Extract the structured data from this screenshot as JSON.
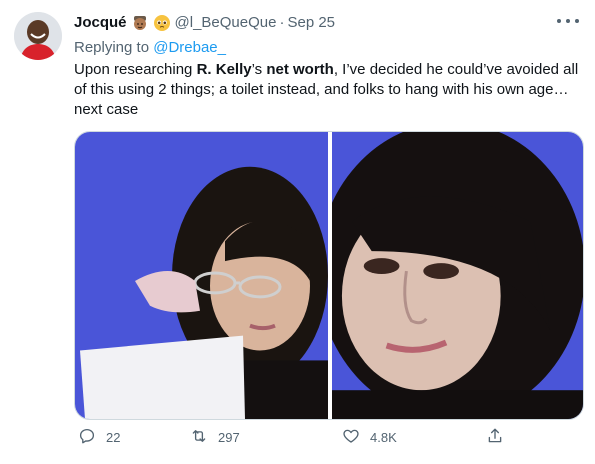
{
  "tweet": {
    "author": {
      "display_name": "Jocqué",
      "handle": "@l_BeQueQue",
      "separator": "·",
      "date": "Sep 25"
    },
    "replying": {
      "prefix": "Replying to ",
      "mention": "@Drebae_"
    },
    "text": {
      "part1": "Upon researching ",
      "bold1": "R. Kelly",
      "part2": "’s ",
      "bold2": "net worth",
      "part3": ", I’ve decided he could’ve avoided all of this using 2 things; a toilet instead, and folks to hang with his own age… next case"
    },
    "actions": {
      "replies": "22",
      "retweets": "297",
      "likes": "4.8K"
    },
    "icons": {
      "more": "more-icon",
      "reply": "reply-icon",
      "retweet": "retweet-icon",
      "like": "heart-icon",
      "share": "share-icon"
    },
    "colors": {
      "text": "#0f1419",
      "secondary": "#536471",
      "link": "#1d9bf0",
      "photo_background": "#4a55d8"
    }
  }
}
